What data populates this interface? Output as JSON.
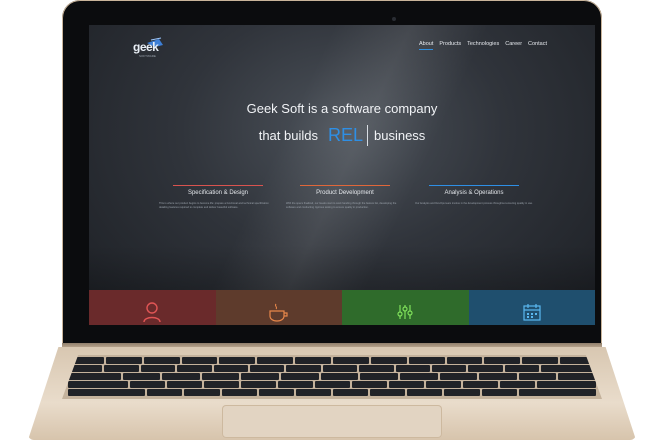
{
  "logo": {
    "text": "geek",
    "subtitle": "SOFTWARE"
  },
  "nav": {
    "items": [
      "About",
      "Products",
      "Technologies",
      "Career",
      "Contact"
    ],
    "active": "About"
  },
  "hero": {
    "line1": "Geek Soft is a software company",
    "line2_pre": "that builds",
    "rotating_word": "REL",
    "line2_post": "business"
  },
  "features": [
    {
      "title": "Specification & Design",
      "color": "#d9534f",
      "text": "This is where our product begins to become life: prepare a functional and technical specification detailing features required to complete and deliver beautiful software."
    },
    {
      "title": "Product Development",
      "color": "#e0673a",
      "text": "With the specs finalized, our Geeks start to work handing through the feature list, developing the software and conducting rigorous testing to ensure quality in production."
    },
    {
      "title": "Analysis & Operations",
      "color": "#2e8fe5",
      "text": "Our Analysis and DevOps team involve in the development process throughout ensuring quality in use."
    }
  ],
  "tiles": [
    {
      "icon": "user-icon",
      "color": "#6a2a2b",
      "icon_color": "#e05555"
    },
    {
      "icon": "coffee-icon",
      "color": "#5e3b2c",
      "icon_color": "#e8874a"
    },
    {
      "icon": "equalizer-icon",
      "color": "#2f6b2b",
      "icon_color": "#7fe05a"
    },
    {
      "icon": "calendar-icon",
      "color": "#1f4f6e",
      "icon_color": "#5ab8f0"
    }
  ]
}
